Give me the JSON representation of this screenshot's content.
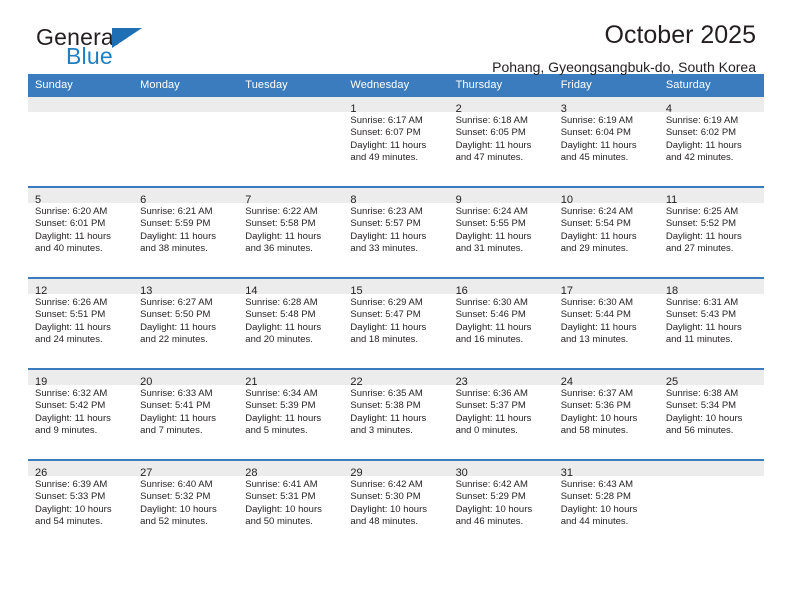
{
  "brand": {
    "name_top": "General",
    "name_bottom": "Blue",
    "accent_color": "#1f7fc4",
    "triangle_color": "#1f6fb5"
  },
  "header": {
    "title": "October 2025",
    "subtitle": "Pohang, Gyeongsangbuk-do, South Korea"
  },
  "theme": {
    "header_row_bg": "#3a7cbe",
    "daynum_band_bg": "#ececec",
    "row_divider": "#3a7cbe",
    "text": "#231f20"
  },
  "weekdays": [
    "Sunday",
    "Monday",
    "Tuesday",
    "Wednesday",
    "Thursday",
    "Friday",
    "Saturday"
  ],
  "weeks": [
    [
      {
        "day": "",
        "lines": []
      },
      {
        "day": "",
        "lines": []
      },
      {
        "day": "",
        "lines": []
      },
      {
        "day": "1",
        "lines": [
          "Sunrise: 6:17 AM",
          "Sunset: 6:07 PM",
          "Daylight: 11 hours",
          "and 49 minutes."
        ]
      },
      {
        "day": "2",
        "lines": [
          "Sunrise: 6:18 AM",
          "Sunset: 6:05 PM",
          "Daylight: 11 hours",
          "and 47 minutes."
        ]
      },
      {
        "day": "3",
        "lines": [
          "Sunrise: 6:19 AM",
          "Sunset: 6:04 PM",
          "Daylight: 11 hours",
          "and 45 minutes."
        ]
      },
      {
        "day": "4",
        "lines": [
          "Sunrise: 6:19 AM",
          "Sunset: 6:02 PM",
          "Daylight: 11 hours",
          "and 42 minutes."
        ]
      }
    ],
    [
      {
        "day": "5",
        "lines": [
          "Sunrise: 6:20 AM",
          "Sunset: 6:01 PM",
          "Daylight: 11 hours",
          "and 40 minutes."
        ]
      },
      {
        "day": "6",
        "lines": [
          "Sunrise: 6:21 AM",
          "Sunset: 5:59 PM",
          "Daylight: 11 hours",
          "and 38 minutes."
        ]
      },
      {
        "day": "7",
        "lines": [
          "Sunrise: 6:22 AM",
          "Sunset: 5:58 PM",
          "Daylight: 11 hours",
          "and 36 minutes."
        ]
      },
      {
        "day": "8",
        "lines": [
          "Sunrise: 6:23 AM",
          "Sunset: 5:57 PM",
          "Daylight: 11 hours",
          "and 33 minutes."
        ]
      },
      {
        "day": "9",
        "lines": [
          "Sunrise: 6:24 AM",
          "Sunset: 5:55 PM",
          "Daylight: 11 hours",
          "and 31 minutes."
        ]
      },
      {
        "day": "10",
        "lines": [
          "Sunrise: 6:24 AM",
          "Sunset: 5:54 PM",
          "Daylight: 11 hours",
          "and 29 minutes."
        ]
      },
      {
        "day": "11",
        "lines": [
          "Sunrise: 6:25 AM",
          "Sunset: 5:52 PM",
          "Daylight: 11 hours",
          "and 27 minutes."
        ]
      }
    ],
    [
      {
        "day": "12",
        "lines": [
          "Sunrise: 6:26 AM",
          "Sunset: 5:51 PM",
          "Daylight: 11 hours",
          "and 24 minutes."
        ]
      },
      {
        "day": "13",
        "lines": [
          "Sunrise: 6:27 AM",
          "Sunset: 5:50 PM",
          "Daylight: 11 hours",
          "and 22 minutes."
        ]
      },
      {
        "day": "14",
        "lines": [
          "Sunrise: 6:28 AM",
          "Sunset: 5:48 PM",
          "Daylight: 11 hours",
          "and 20 minutes."
        ]
      },
      {
        "day": "15",
        "lines": [
          "Sunrise: 6:29 AM",
          "Sunset: 5:47 PM",
          "Daylight: 11 hours",
          "and 18 minutes."
        ]
      },
      {
        "day": "16",
        "lines": [
          "Sunrise: 6:30 AM",
          "Sunset: 5:46 PM",
          "Daylight: 11 hours",
          "and 16 minutes."
        ]
      },
      {
        "day": "17",
        "lines": [
          "Sunrise: 6:30 AM",
          "Sunset: 5:44 PM",
          "Daylight: 11 hours",
          "and 13 minutes."
        ]
      },
      {
        "day": "18",
        "lines": [
          "Sunrise: 6:31 AM",
          "Sunset: 5:43 PM",
          "Daylight: 11 hours",
          "and 11 minutes."
        ]
      }
    ],
    [
      {
        "day": "19",
        "lines": [
          "Sunrise: 6:32 AM",
          "Sunset: 5:42 PM",
          "Daylight: 11 hours",
          "and 9 minutes."
        ]
      },
      {
        "day": "20",
        "lines": [
          "Sunrise: 6:33 AM",
          "Sunset: 5:41 PM",
          "Daylight: 11 hours",
          "and 7 minutes."
        ]
      },
      {
        "day": "21",
        "lines": [
          "Sunrise: 6:34 AM",
          "Sunset: 5:39 PM",
          "Daylight: 11 hours",
          "and 5 minutes."
        ]
      },
      {
        "day": "22",
        "lines": [
          "Sunrise: 6:35 AM",
          "Sunset: 5:38 PM",
          "Daylight: 11 hours",
          "and 3 minutes."
        ]
      },
      {
        "day": "23",
        "lines": [
          "Sunrise: 6:36 AM",
          "Sunset: 5:37 PM",
          "Daylight: 11 hours",
          "and 0 minutes."
        ]
      },
      {
        "day": "24",
        "lines": [
          "Sunrise: 6:37 AM",
          "Sunset: 5:36 PM",
          "Daylight: 10 hours",
          "and 58 minutes."
        ]
      },
      {
        "day": "25",
        "lines": [
          "Sunrise: 6:38 AM",
          "Sunset: 5:34 PM",
          "Daylight: 10 hours",
          "and 56 minutes."
        ]
      }
    ],
    [
      {
        "day": "26",
        "lines": [
          "Sunrise: 6:39 AM",
          "Sunset: 5:33 PM",
          "Daylight: 10 hours",
          "and 54 minutes."
        ]
      },
      {
        "day": "27",
        "lines": [
          "Sunrise: 6:40 AM",
          "Sunset: 5:32 PM",
          "Daylight: 10 hours",
          "and 52 minutes."
        ]
      },
      {
        "day": "28",
        "lines": [
          "Sunrise: 6:41 AM",
          "Sunset: 5:31 PM",
          "Daylight: 10 hours",
          "and 50 minutes."
        ]
      },
      {
        "day": "29",
        "lines": [
          "Sunrise: 6:42 AM",
          "Sunset: 5:30 PM",
          "Daylight: 10 hours",
          "and 48 minutes."
        ]
      },
      {
        "day": "30",
        "lines": [
          "Sunrise: 6:42 AM",
          "Sunset: 5:29 PM",
          "Daylight: 10 hours",
          "and 46 minutes."
        ]
      },
      {
        "day": "31",
        "lines": [
          "Sunrise: 6:43 AM",
          "Sunset: 5:28 PM",
          "Daylight: 10 hours",
          "and 44 minutes."
        ]
      },
      {
        "day": "",
        "lines": []
      }
    ]
  ]
}
